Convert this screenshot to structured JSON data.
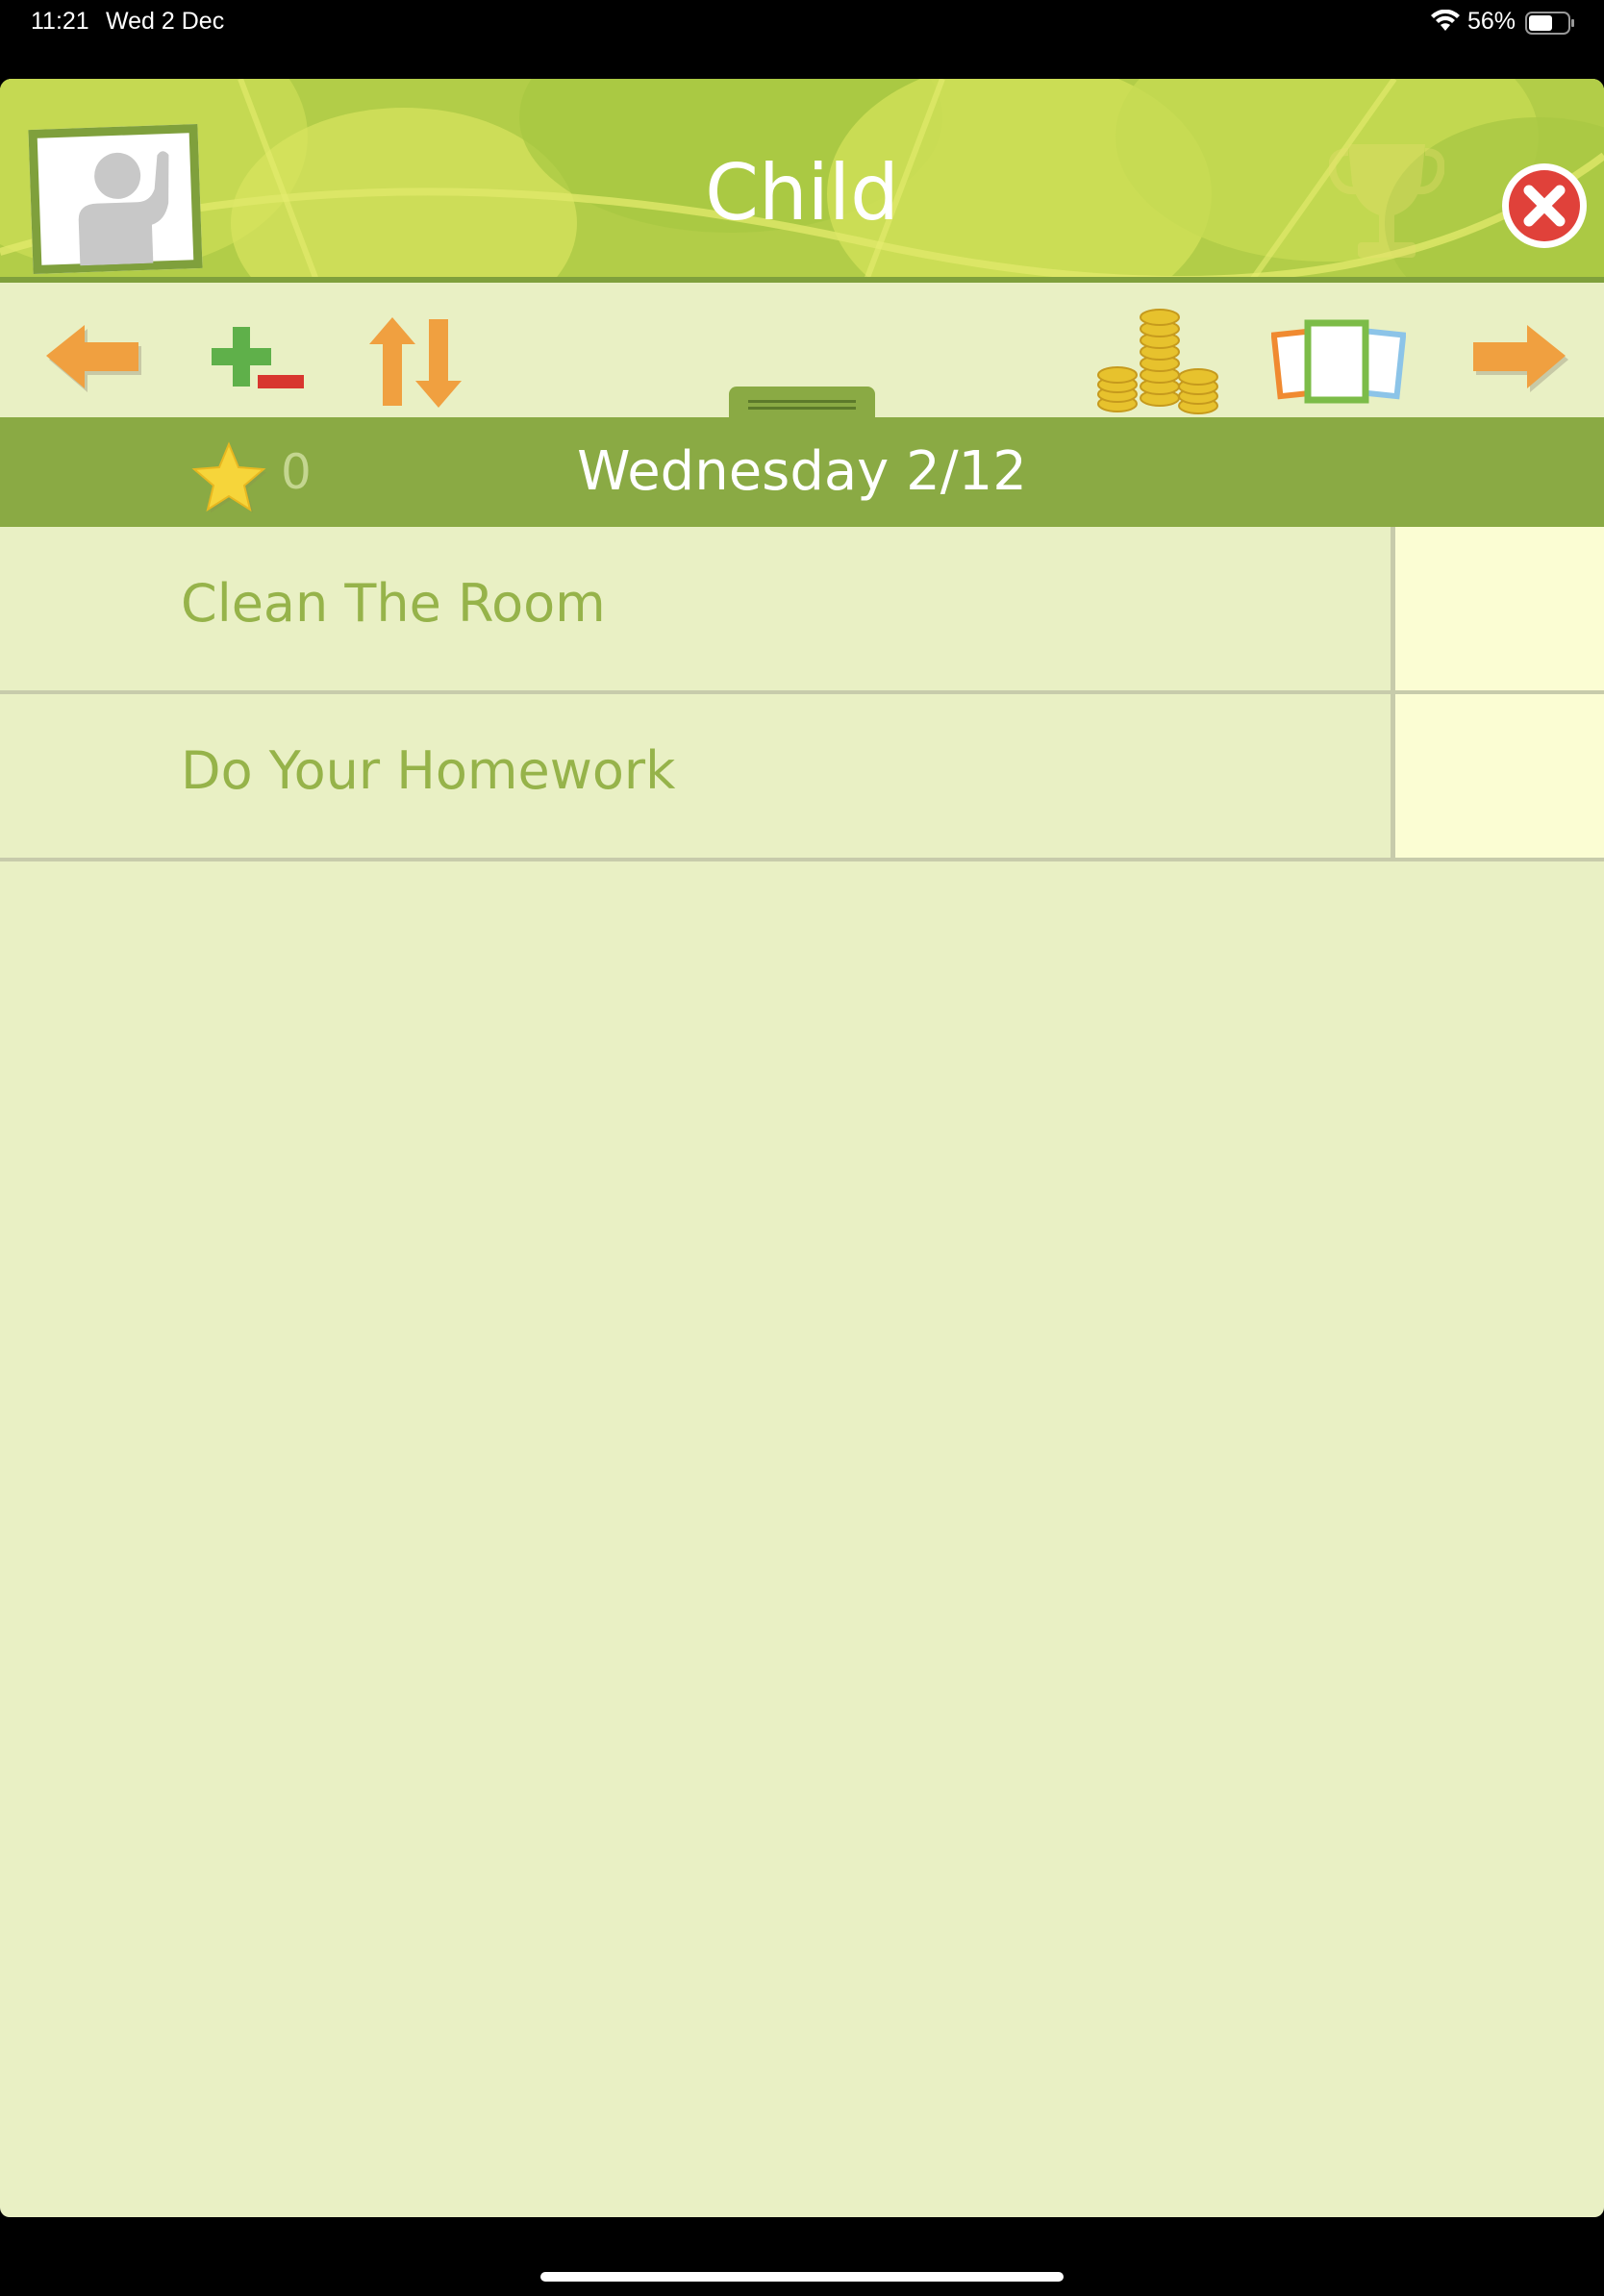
{
  "status_bar": {
    "time": "11:21",
    "date": "Wed 2 Dec",
    "battery": "56%"
  },
  "header": {
    "title": "Child",
    "colors": {
      "header_green": "#b6d04d",
      "leaf_light": "#d6e25a",
      "frame_green": "#7fa03c"
    }
  },
  "toolbar": {
    "icons": [
      "arrow-left-icon",
      "add-remove-icon",
      "sort-icon",
      "coins-icon",
      "cards-icon",
      "arrow-right-icon"
    ]
  },
  "date_bar": {
    "stars": "0",
    "date": "Wednesday 2/12"
  },
  "tasks": [
    {
      "label": "Clean The Room"
    },
    {
      "label": "Do Your Homework"
    }
  ],
  "colors": {
    "background": "#e9f0c4",
    "date_bar": "#8aaa44",
    "task_text": "#96b34a",
    "task_cell": "#fbfdd3",
    "orange": "#f0a040",
    "close_red": "#e0413a"
  }
}
